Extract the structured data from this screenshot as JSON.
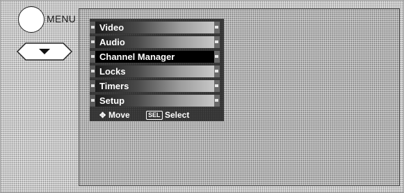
{
  "remote": {
    "menu_label": "MENU",
    "down_icon": "down-arrow-icon"
  },
  "menu": {
    "items": [
      {
        "label": "Video",
        "selected": false
      },
      {
        "label": "Audio",
        "selected": false
      },
      {
        "label": "Channel Manager",
        "selected": true
      },
      {
        "label": "Locks",
        "selected": false
      },
      {
        "label": "Timers",
        "selected": false
      },
      {
        "label": "Setup",
        "selected": false
      }
    ],
    "footer": {
      "move_icon": "dpad-move-icon",
      "move_label": "Move",
      "sel_icon": "SEL",
      "select_label": "Select"
    }
  }
}
